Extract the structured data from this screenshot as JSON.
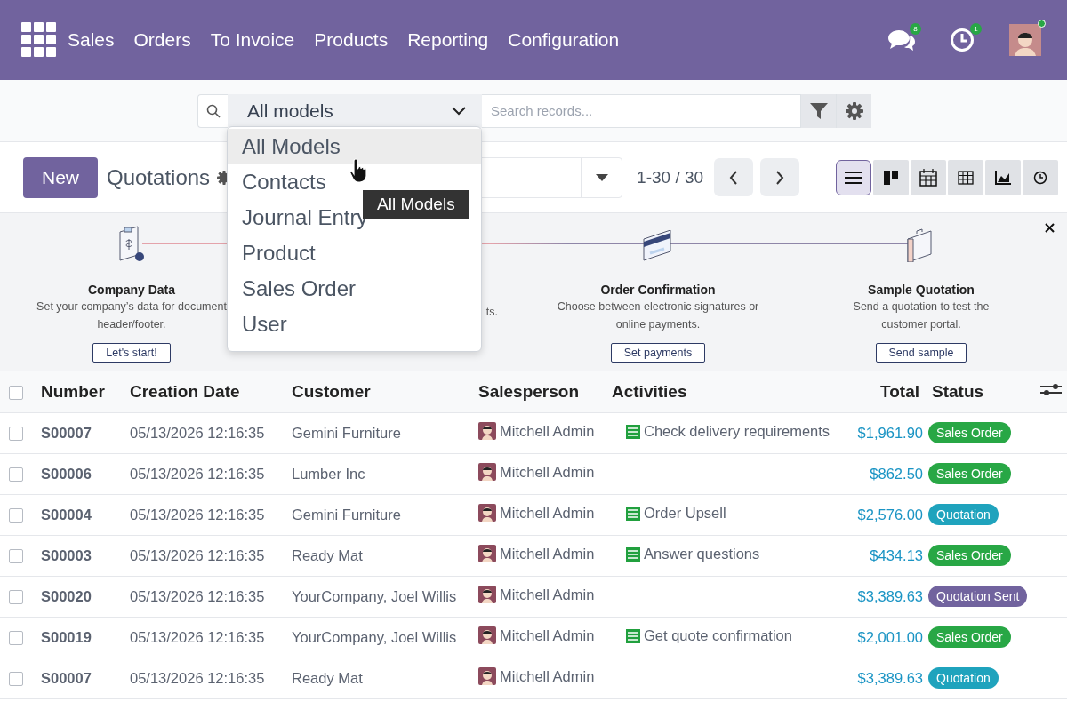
{
  "navbar": {
    "menus": [
      "Sales",
      "Orders",
      "To Invoice",
      "Products",
      "Reporting",
      "Configuration"
    ],
    "chat_badge": "8",
    "activity_badge": "1",
    "online": true
  },
  "search": {
    "model": "All models",
    "placeholder": "Search records...",
    "dropdown": [
      {
        "label": "All Models",
        "selected": true
      },
      {
        "label": "Contacts",
        "selected": false
      },
      {
        "label": "Journal Entry",
        "selected": false
      },
      {
        "label": "Product",
        "selected": false
      },
      {
        "label": "Sales Order",
        "selected": false
      },
      {
        "label": "User",
        "selected": false
      }
    ],
    "tooltip": "All Models"
  },
  "control": {
    "new_button": "New",
    "title": "Quotations",
    "pager": "1-30 / 30",
    "views": [
      {
        "kind": "list",
        "selected": true
      },
      {
        "kind": "kanban",
        "selected": false
      },
      {
        "kind": "calendar",
        "selected": false
      },
      {
        "kind": "pivot",
        "selected": false
      },
      {
        "kind": "graph",
        "selected": false
      },
      {
        "kind": "activity",
        "selected": false
      }
    ]
  },
  "onboarding": {
    "steps": [
      {
        "kind": "company",
        "title": "Company Data",
        "lines": [
          "Set your company’s data for document",
          "header/footer."
        ],
        "button": "Let's start!"
      },
      {
        "kind": "hidden",
        "lines": [
          "ts."
        ]
      },
      {
        "kind": "card",
        "title": "Order Confirmation",
        "lines": [
          "Choose between electronic signatures or",
          "online payments."
        ],
        "button": "Set payments"
      },
      {
        "kind": "briefcase",
        "title": "Sample Quotation",
        "lines": [
          "Send a quotation to test the",
          "customer portal."
        ],
        "button": "Send sample"
      }
    ]
  },
  "table": {
    "select_all": false,
    "columns": [
      "Number",
      "Creation Date",
      "Customer",
      "Salesperson",
      "Activities",
      "Total",
      "Status"
    ],
    "rows": [
      {
        "checked": false,
        "number": "S00007",
        "date": "05/13/2026 12:16:35",
        "customer": "Gemini Furniture",
        "salesperson": "Mitchell Admin",
        "activity": "Check delivery requirements",
        "total": "$1,961.90",
        "status": "Sales Order",
        "color": "#28a745"
      },
      {
        "checked": false,
        "number": "S00006",
        "date": "05/13/2026 12:16:35",
        "customer": "Lumber Inc",
        "salesperson": "Mitchell Admin",
        "total": "$862.50",
        "status": "Sales Order",
        "color": "#28a745"
      },
      {
        "checked": false,
        "number": "S00004",
        "date": "05/13/2026 12:16:35",
        "customer": "Gemini Furniture",
        "salesperson": "Mitchell Admin",
        "activity": "Order Upsell",
        "total": "$2,576.00",
        "status": "Quotation",
        "color": "#1fa3bd"
      },
      {
        "checked": false,
        "number": "S00003",
        "date": "05/13/2026 12:16:35",
        "customer": "Ready Mat",
        "salesperson": "Mitchell Admin",
        "activity": "Answer questions",
        "total": "$434.13",
        "status": "Sales Order",
        "color": "#28a745"
      },
      {
        "checked": false,
        "number": "S00020",
        "date": "05/13/2026 12:16:35",
        "customer": "YourCompany, Joel Willis",
        "salesperson": "Mitchell Admin",
        "total": "$3,389.63",
        "status": "Quotation Sent",
        "color": "#71639e"
      },
      {
        "checked": false,
        "number": "S00019",
        "date": "05/13/2026 12:16:35",
        "customer": "YourCompany, Joel Willis",
        "salesperson": "Mitchell Admin",
        "activity": "Get quote confirmation",
        "total": "$2,001.00",
        "status": "Sales Order",
        "color": "#28a745"
      },
      {
        "checked": false,
        "number": "S00007",
        "date": "05/13/2026 12:16:35",
        "customer": "Ready Mat",
        "salesperson": "Mitchell Admin",
        "total": "$3,389.63",
        "status": "Quotation",
        "color": "#1fa3bd"
      }
    ]
  }
}
